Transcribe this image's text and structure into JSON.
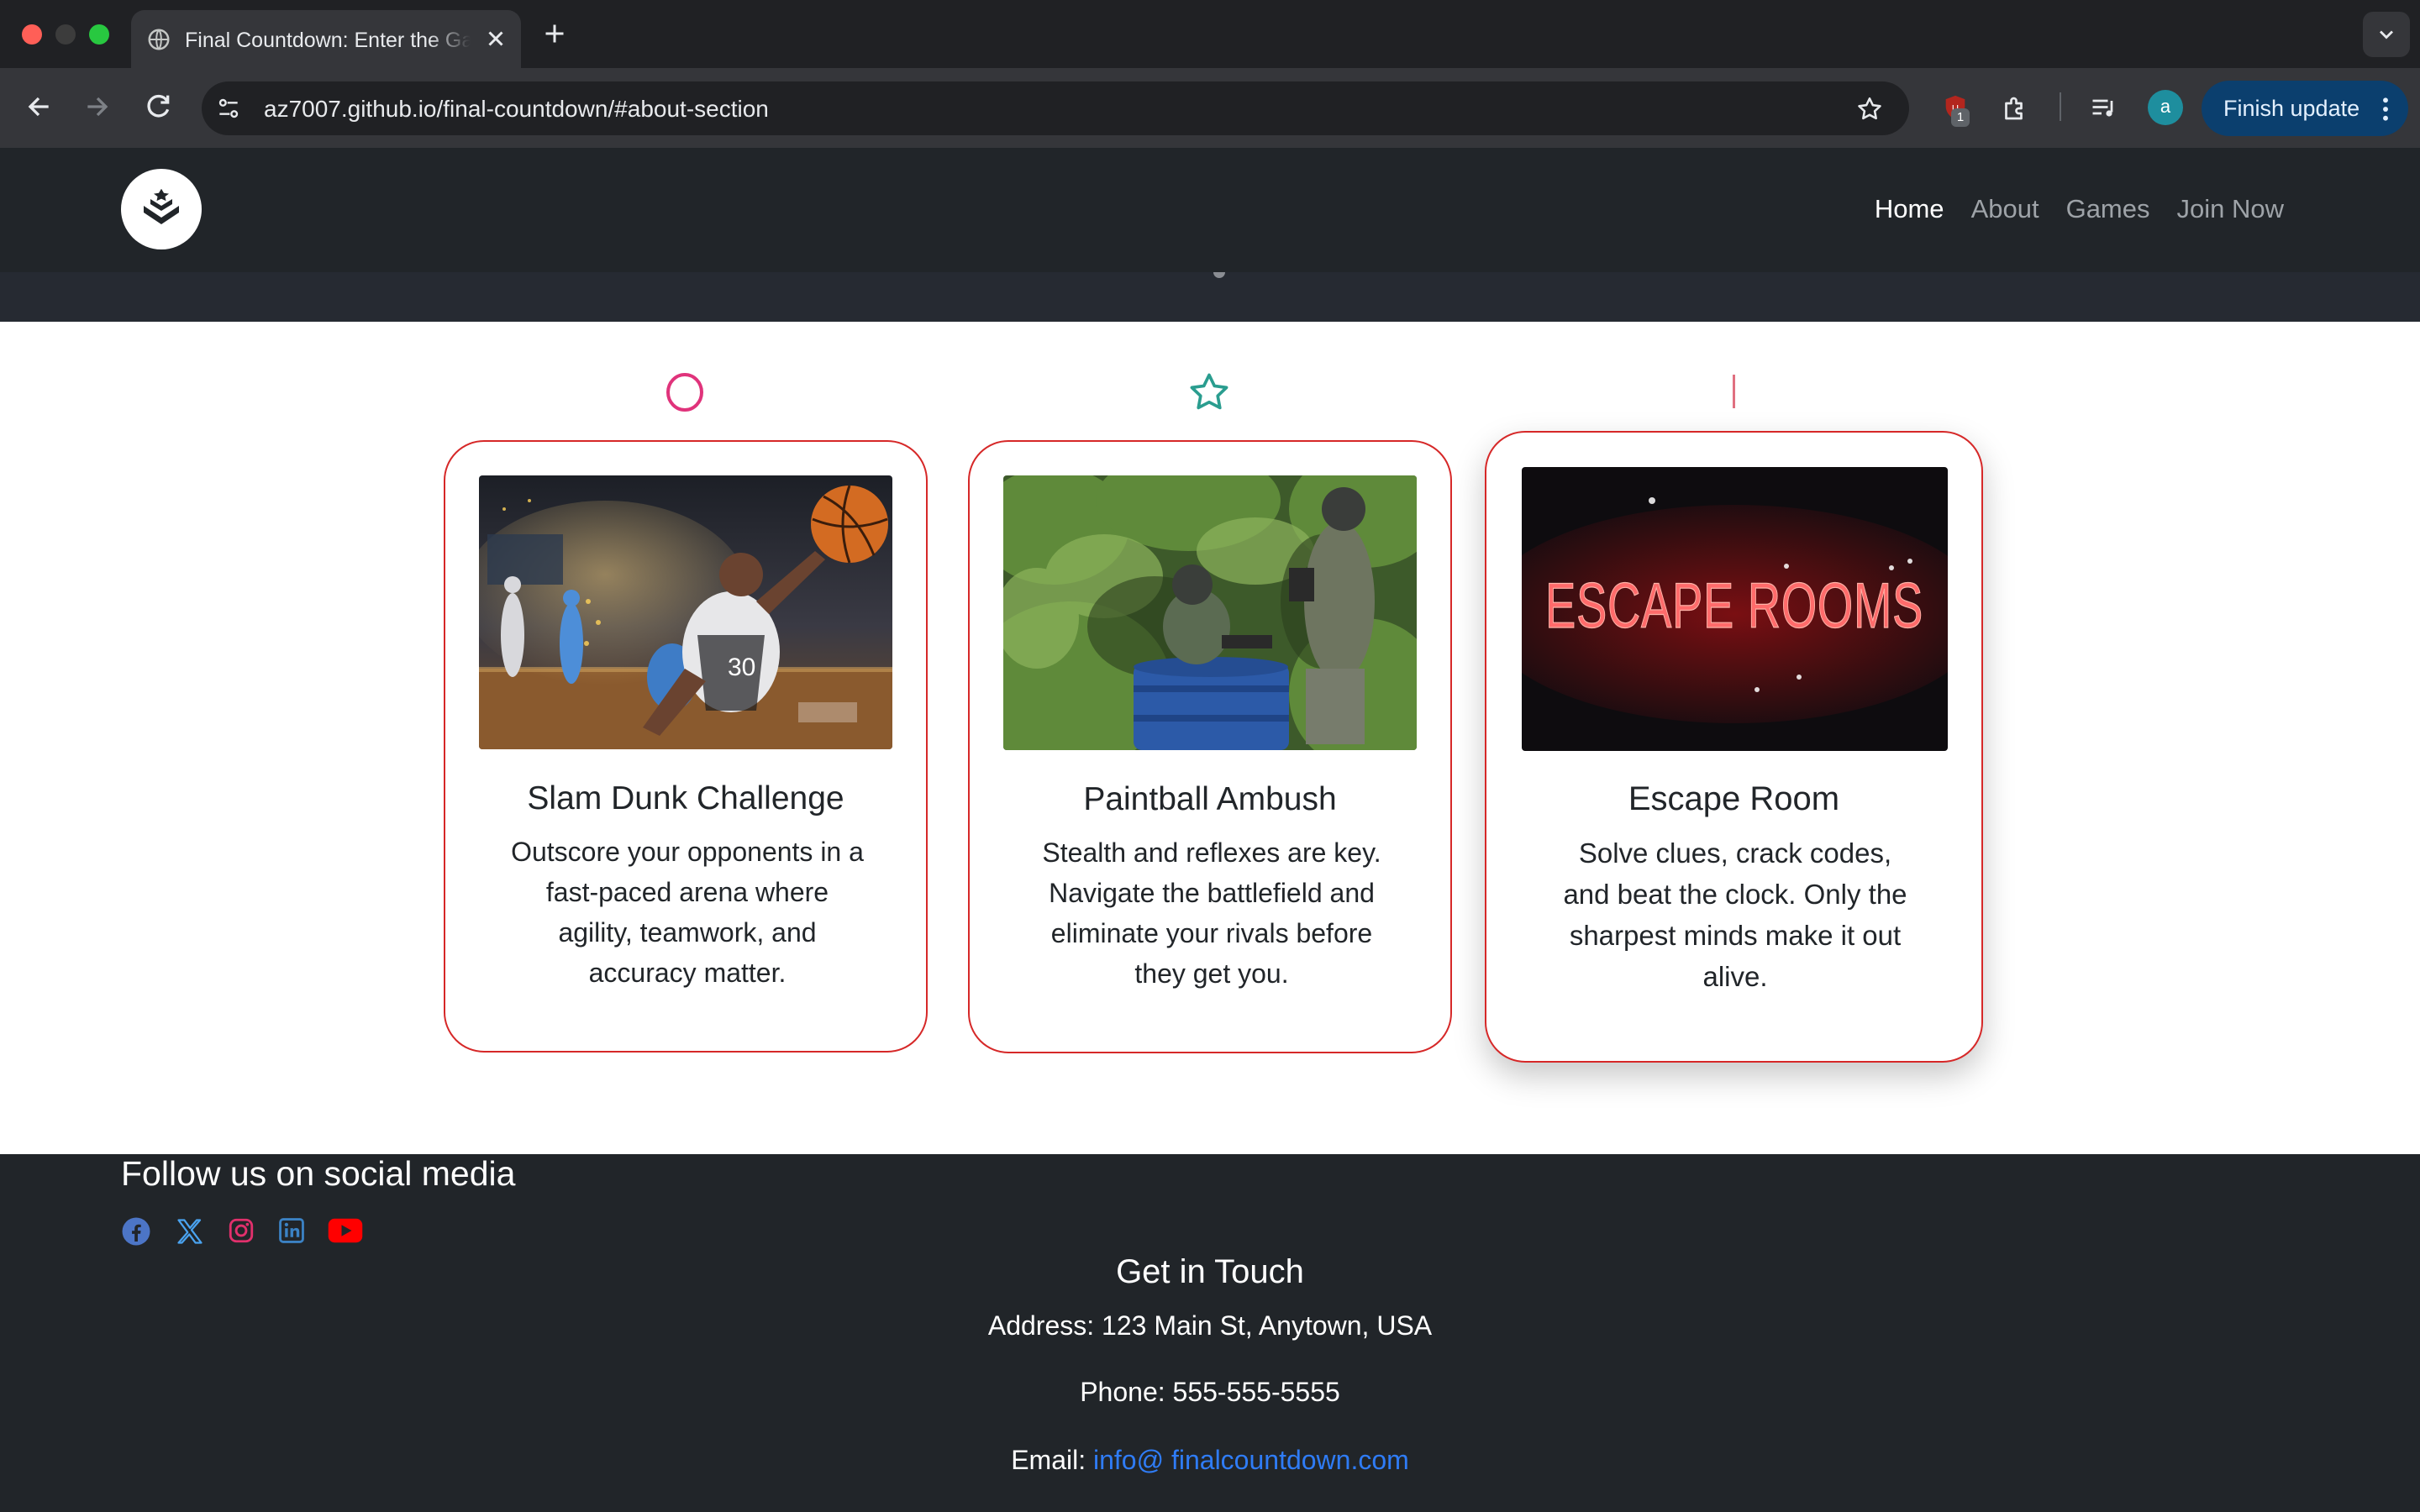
{
  "browser": {
    "tab_title": "Final Countdown: Enter the Game",
    "url": "az7007.github.io/final-countdown/#about-section",
    "extension_badge": "1",
    "profile_initial": "a",
    "finish_update_label": "Finish update",
    "colors": {
      "close": "#ff5f57",
      "minimize": "#3c3c3c",
      "maximize": "#28c840"
    }
  },
  "navbar": {
    "links": [
      {
        "label": "Home",
        "active": true
      },
      {
        "label": "About",
        "active": false
      },
      {
        "label": "Games",
        "active": false
      },
      {
        "label": "Join Now",
        "active": false
      }
    ]
  },
  "games": {
    "cards": [
      {
        "title": "Slam Dunk Challenge",
        "description": "Outscore your opponents in a fast-paced arena where agility, teamwork, and accuracy matter.",
        "image": "basketball-player-dunking"
      },
      {
        "title": "Paintball Ambush",
        "description": "Stealth and reflexes are key. Navigate the battlefield and eliminate your rivals before they get you.",
        "image": "paintball-players-in-bushes"
      },
      {
        "title": "Escape Room",
        "description": "Solve clues, crack codes, and beat the clock. Only the sharpest minds make it out alive.",
        "image": "neon-sign",
        "image_text": "ESCAPE ROOMS"
      }
    ],
    "decor_icons": [
      "circle-icon",
      "star-icon",
      "line-icon"
    ]
  },
  "footer": {
    "follow_title": "Follow us on social media",
    "social": [
      {
        "name": "facebook-icon",
        "color": "#4c75c6"
      },
      {
        "name": "x-icon",
        "color": "#4aa3f0"
      },
      {
        "name": "instagram-icon",
        "color": "#e1306c"
      },
      {
        "name": "linkedin-icon",
        "color": "#3b82c4"
      },
      {
        "name": "youtube-icon",
        "color": "#ff0000"
      }
    ],
    "contact_title": "Get in Touch",
    "address": "Address: 123 Main St, Anytown, USA",
    "phone": "Phone: 555-555-5555",
    "email_label": "Email: ",
    "email": "info@ finalcountdown.com"
  }
}
